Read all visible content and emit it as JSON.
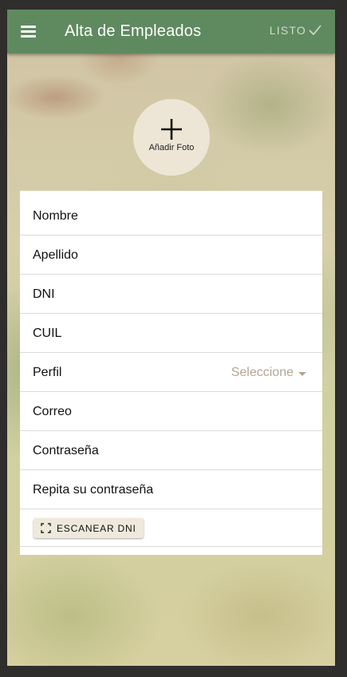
{
  "header": {
    "title": "Alta de Empleados",
    "done_label": "LISTO",
    "menu_icon": "menu-icon",
    "done_icon": "check-icon",
    "bar_color": "#5f8a5f"
  },
  "photo": {
    "label": "Añadir Foto",
    "icon": "plus-icon"
  },
  "form": {
    "fields": [
      {
        "label": "Nombre"
      },
      {
        "label": "Apellido"
      },
      {
        "label": "DNI"
      },
      {
        "label": "CUIL"
      },
      {
        "label": "Perfil",
        "select_value": "Seleccione"
      },
      {
        "label": "Correo"
      },
      {
        "label": "Contraseña"
      },
      {
        "label": "Repita su contraseña"
      }
    ],
    "scan_button": {
      "label": "ESCANEAR DNI",
      "icon": "scan-frame-icon"
    }
  }
}
